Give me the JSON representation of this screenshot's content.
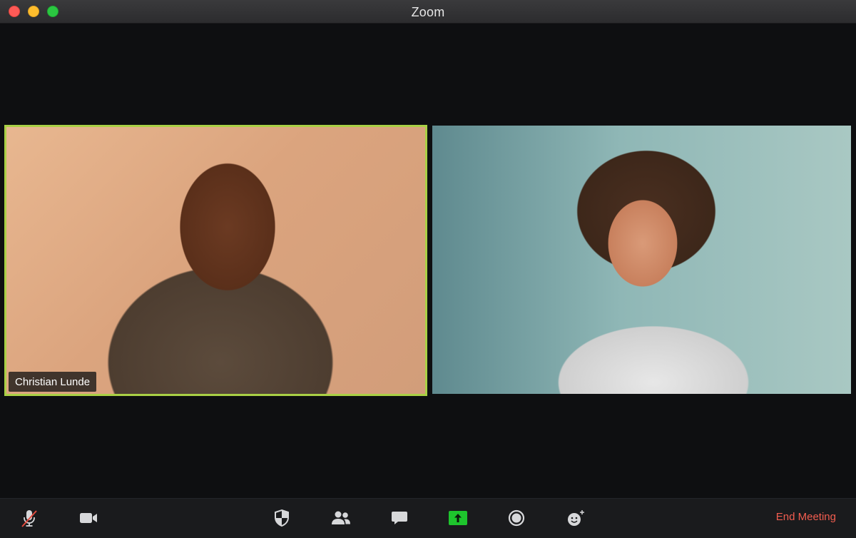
{
  "window": {
    "title": "Zoom"
  },
  "participants": [
    {
      "name": "Christian Lunde",
      "active_speaker": true
    },
    {
      "name": "",
      "active_speaker": false
    }
  ],
  "toolbar": {
    "items": [
      {
        "name": "mute",
        "icon": "microphone-muted-icon"
      },
      {
        "name": "video",
        "icon": "video-camera-icon"
      },
      {
        "name": "security",
        "icon": "shield-icon"
      },
      {
        "name": "participants",
        "icon": "people-icon"
      },
      {
        "name": "chat",
        "icon": "chat-bubble-icon"
      },
      {
        "name": "share-screen",
        "icon": "share-arrow-icon"
      },
      {
        "name": "record",
        "icon": "record-icon"
      },
      {
        "name": "reactions",
        "icon": "smiley-plus-icon"
      }
    ],
    "end_label": "End Meeting"
  },
  "colors": {
    "active_speaker_border": "#a9d045",
    "share_green": "#1ec52d",
    "end_red": "#f25d4f",
    "mute_slash": "#e34b3e"
  }
}
